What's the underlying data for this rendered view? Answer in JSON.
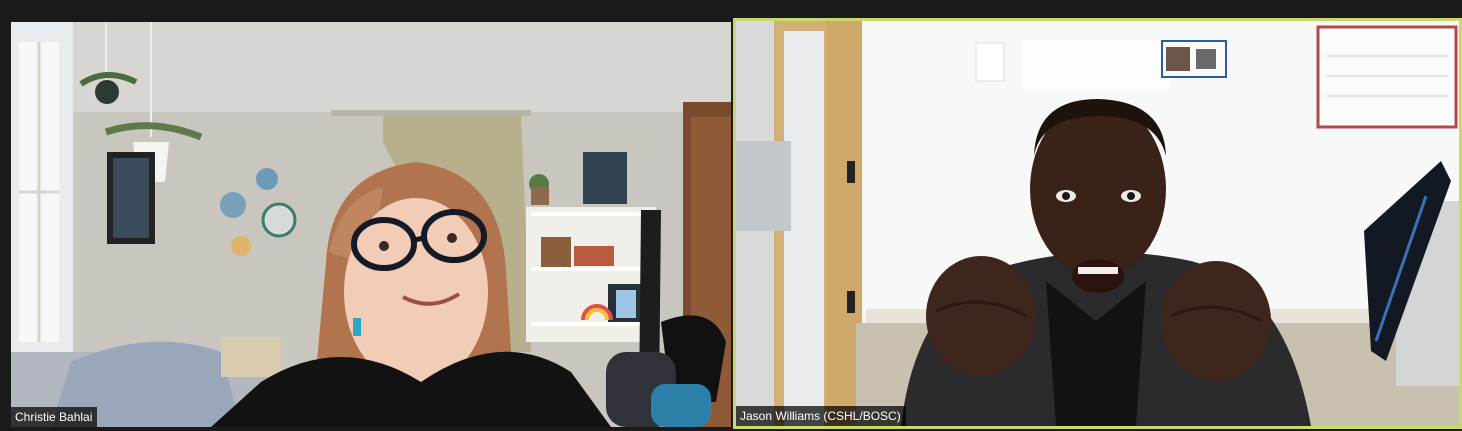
{
  "meeting": {
    "participants": [
      {
        "name": "Christie Bahlai",
        "active_speaker": false
      },
      {
        "name": "Jason Williams (CSHL/BOSC)",
        "active_speaker": true
      }
    ]
  },
  "colors": {
    "background": "#1a1a1a",
    "active_speaker_border": "#c9d96a",
    "label_background": "#000000",
    "label_text": "#ffffff"
  }
}
